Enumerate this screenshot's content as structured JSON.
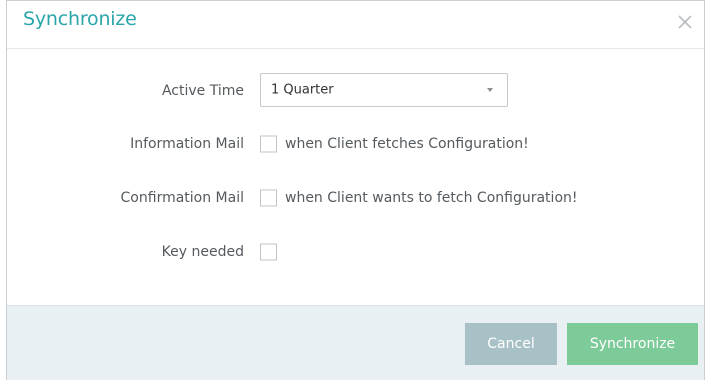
{
  "dialog": {
    "title": "Synchronize",
    "close_icon": "close-icon"
  },
  "form": {
    "active_time": {
      "label": "Active Time",
      "selected_value": "1 Quarter"
    },
    "information_mail": {
      "label": "Information Mail",
      "checkbox_text": "when Client fetches Configuration!",
      "checked": false
    },
    "confirmation_mail": {
      "label": "Confirmation Mail",
      "checkbox_text": "when Client wants to fetch Configuration!",
      "checked": false
    },
    "key_needed": {
      "label": "Key needed",
      "checked": false
    }
  },
  "footer": {
    "cancel_label": "Cancel",
    "synchronize_label": "Synchronize"
  },
  "colors": {
    "title": "#2aa5a8",
    "footer_bg": "#e9f0f3",
    "cancel_button": "#a8c1c7",
    "synchronize_button": "#7ecb9a"
  }
}
